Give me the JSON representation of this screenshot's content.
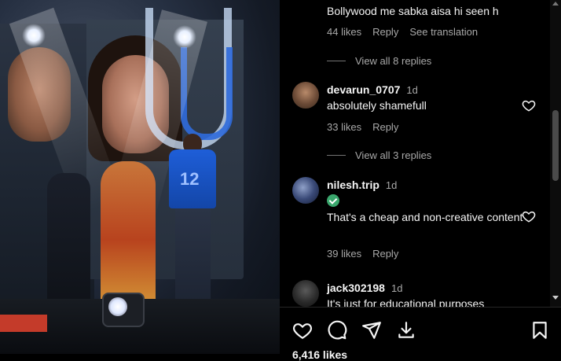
{
  "comments": [
    {
      "text": "Bollywood me sabka aisa hi seen h",
      "likes": "44 likes",
      "reply": "Reply",
      "translate": "See translation",
      "view_replies": "View all 8 replies"
    },
    {
      "username": "devarun_0707",
      "time": "1d",
      "text": "absolutely shamefull",
      "likes": "33 likes",
      "reply": "Reply",
      "view_replies": "View all 3 replies"
    },
    {
      "username": "nilesh.trip",
      "time": "1d",
      "verified": true,
      "text": "That's a cheap and non-creative content",
      "likes": "39 likes",
      "reply": "Reply"
    },
    {
      "username": "jack302198",
      "time": "1d",
      "text": "It's just for educational purposes"
    }
  ],
  "post": {
    "likes_count": "6,416 likes"
  },
  "icons": {
    "like": "heart-icon",
    "comment": "comment-icon",
    "share": "share-icon",
    "save_download": "download-icon",
    "bookmark": "bookmark-icon"
  }
}
